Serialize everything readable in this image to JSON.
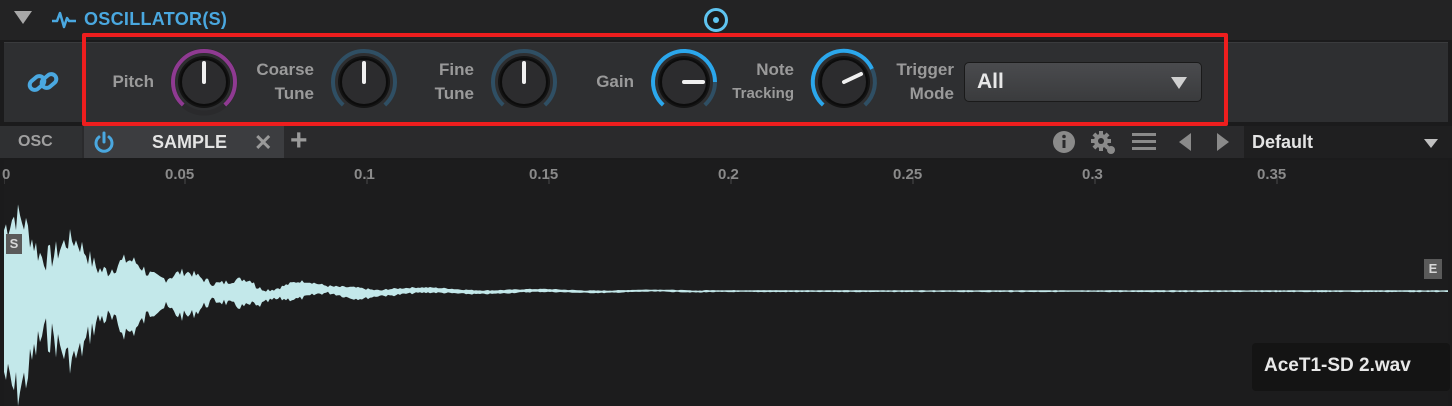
{
  "header": {
    "title": "OSCILLATOR(S)"
  },
  "params": {
    "pitch": "Pitch",
    "coarse_tune_1": "Coarse",
    "coarse_tune_2": "Tune",
    "fine_tune_1": "Fine",
    "fine_tune_2": "Tune",
    "gain": "Gain",
    "note_tracking_1": "Note",
    "note_tracking_2": "Tracking",
    "trigger_mode_1": "Trigger",
    "trigger_mode_2": "Mode",
    "trigger_mode_value": "All"
  },
  "tabs": {
    "osc": "OSC",
    "sample": "SAMPLE",
    "preset": "Default"
  },
  "ruler": {
    "ticks": [
      "0",
      "0.05",
      "0.1",
      "0.15",
      "0.2",
      "0.25",
      "0.3",
      "0.35"
    ]
  },
  "markers": {
    "start": "S",
    "end": "E"
  },
  "file": {
    "name": "AceT1-SD 2.wav"
  },
  "colors": {
    "accent": "#4aa8e0",
    "waveform": "#c3e8ea",
    "pitch_ring": "#9b3c9c",
    "highlight": "#ee1e1e"
  }
}
